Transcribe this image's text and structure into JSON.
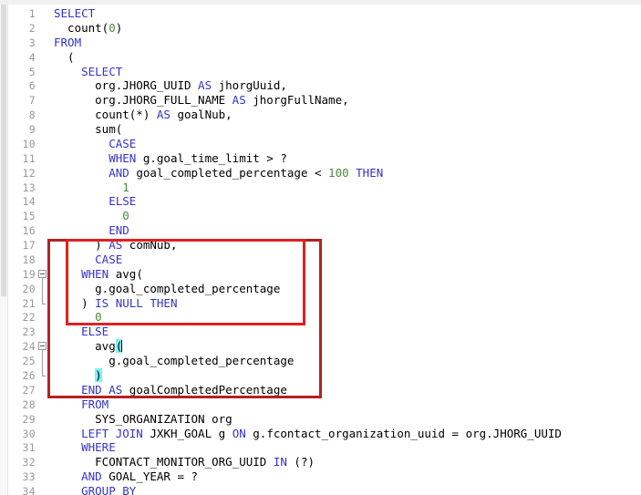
{
  "editor": {
    "language": "SQL",
    "caret_line": 24,
    "colors": {
      "keyword": "#3333cc",
      "number": "#4d8a3f",
      "plain": "#000000",
      "line_number": "#999999",
      "bracket_match_highlight": "#7ff0f0",
      "annotation_outer": "#b22222",
      "annotation_inner": "#e02020",
      "background": "#ffffff"
    },
    "lines": [
      {
        "n": "1",
        "tokens": [
          {
            "t": "kw",
            "s": "SELECT"
          }
        ]
      },
      {
        "n": "2",
        "tokens": [
          {
            "t": "pl",
            "s": "  count("
          },
          {
            "t": "num",
            "s": "0"
          },
          {
            "t": "pl",
            "s": ")"
          }
        ]
      },
      {
        "n": "3",
        "tokens": [
          {
            "t": "kw",
            "s": "FROM"
          }
        ]
      },
      {
        "n": "4",
        "tokens": [
          {
            "t": "pl",
            "s": "  ("
          }
        ]
      },
      {
        "n": "5",
        "tokens": [
          {
            "t": "kw",
            "s": "    SELECT"
          }
        ]
      },
      {
        "n": "6",
        "tokens": [
          {
            "t": "pl",
            "s": "      org.JHORG_UUID "
          },
          {
            "t": "kw",
            "s": "AS"
          },
          {
            "t": "pl",
            "s": " jhorgUuid,"
          }
        ]
      },
      {
        "n": "7",
        "tokens": [
          {
            "t": "pl",
            "s": "      org.JHORG_FULL_NAME "
          },
          {
            "t": "kw",
            "s": "AS"
          },
          {
            "t": "pl",
            "s": " jhorgFullName,"
          }
        ]
      },
      {
        "n": "8",
        "tokens": [
          {
            "t": "pl",
            "s": "      count(*) "
          },
          {
            "t": "kw",
            "s": "AS"
          },
          {
            "t": "pl",
            "s": " goalNub,"
          }
        ]
      },
      {
        "n": "9",
        "tokens": [
          {
            "t": "pl",
            "s": "      sum("
          }
        ]
      },
      {
        "n": "10",
        "tokens": [
          {
            "t": "kw",
            "s": "        CASE"
          }
        ]
      },
      {
        "n": "11",
        "tokens": [
          {
            "t": "kw",
            "s": "        WHEN"
          },
          {
            "t": "pl",
            "s": " g.goal_time_limit > ?"
          }
        ]
      },
      {
        "n": "12",
        "tokens": [
          {
            "t": "kw",
            "s": "        AND"
          },
          {
            "t": "pl",
            "s": " goal_completed_percentage < "
          },
          {
            "t": "num",
            "s": "100"
          },
          {
            "t": "pl",
            "s": " "
          },
          {
            "t": "kw",
            "s": "THEN"
          }
        ]
      },
      {
        "n": "13",
        "tokens": [
          {
            "t": "num",
            "s": "          1"
          }
        ]
      },
      {
        "n": "14",
        "tokens": [
          {
            "t": "kw",
            "s": "        ELSE"
          }
        ]
      },
      {
        "n": "15",
        "tokens": [
          {
            "t": "num",
            "s": "          0"
          }
        ]
      },
      {
        "n": "16",
        "tokens": [
          {
            "t": "kw",
            "s": "        END"
          }
        ]
      },
      {
        "n": "17",
        "tokens": [
          {
            "t": "pl",
            "s": "      ) "
          },
          {
            "t": "kw",
            "s": "AS"
          },
          {
            "t": "pl",
            "s": " comNub,"
          }
        ]
      },
      {
        "n": "18",
        "tokens": [
          {
            "t": "kw",
            "s": "      CASE"
          }
        ]
      },
      {
        "n": "19",
        "tokens": [
          {
            "t": "kw",
            "s": "    WHEN"
          },
          {
            "t": "pl",
            "s": " avg("
          }
        ]
      },
      {
        "n": "20",
        "tokens": [
          {
            "t": "pl",
            "s": "      g.goal_completed_percentage"
          }
        ]
      },
      {
        "n": "21",
        "tokens": [
          {
            "t": "pl",
            "s": "    ) "
          },
          {
            "t": "kw",
            "s": "IS NULL THEN"
          }
        ]
      },
      {
        "n": "22",
        "tokens": [
          {
            "t": "num",
            "s": "      0"
          }
        ]
      },
      {
        "n": "23",
        "tokens": [
          {
            "t": "kw",
            "s": "    ELSE"
          }
        ]
      },
      {
        "n": "24",
        "tokens": [
          {
            "t": "pl",
            "s": "      avg"
          },
          {
            "t": "brk",
            "s": "("
          },
          {
            "t": "caret",
            "s": ""
          }
        ]
      },
      {
        "n": "25",
        "tokens": [
          {
            "t": "pl",
            "s": "        g.goal_completed_percentage"
          }
        ]
      },
      {
        "n": "26",
        "tokens": [
          {
            "t": "pl",
            "s": "      "
          },
          {
            "t": "brk",
            "s": ")"
          }
        ]
      },
      {
        "n": "27",
        "tokens": [
          {
            "t": "kw",
            "s": "    END AS"
          },
          {
            "t": "pl",
            "s": " goalCompletedPercentage"
          }
        ]
      },
      {
        "n": "28",
        "tokens": [
          {
            "t": "kw",
            "s": "    FROM"
          }
        ]
      },
      {
        "n": "29",
        "tokens": [
          {
            "t": "pl",
            "s": "      SYS_ORGANIZATION org"
          }
        ]
      },
      {
        "n": "30",
        "tokens": [
          {
            "t": "kw",
            "s": "    LEFT JOIN"
          },
          {
            "t": "pl",
            "s": " JXKH_GOAL g "
          },
          {
            "t": "kw",
            "s": "ON"
          },
          {
            "t": "pl",
            "s": " g.fcontact_organization_uuid = org.JHORG_UUID"
          }
        ]
      },
      {
        "n": "31",
        "tokens": [
          {
            "t": "kw",
            "s": "    WHERE"
          }
        ]
      },
      {
        "n": "32",
        "tokens": [
          {
            "t": "pl",
            "s": "      FCONTACT_MONITOR_ORG_UUID "
          },
          {
            "t": "kw",
            "s": "IN"
          },
          {
            "t": "pl",
            "s": " (?)"
          }
        ]
      },
      {
        "n": "33",
        "tokens": [
          {
            "t": "kw",
            "s": "    AND"
          },
          {
            "t": "pl",
            "s": " GOAL_YEAR = ?"
          }
        ]
      },
      {
        "n": "34",
        "tokens": [
          {
            "t": "kw",
            "s": "    GROUP BY"
          }
        ]
      }
    ],
    "fold_markers": [
      {
        "line": "19",
        "end_line": "21"
      },
      {
        "line": "24",
        "end_line": "26"
      }
    ],
    "annotations": [
      {
        "id": "outer",
        "style": "annot-outer",
        "from_line": "17",
        "to_line": "27"
      },
      {
        "id": "inner",
        "style": "annot-inner",
        "from_line": "17",
        "to_line": "22"
      }
    ]
  }
}
